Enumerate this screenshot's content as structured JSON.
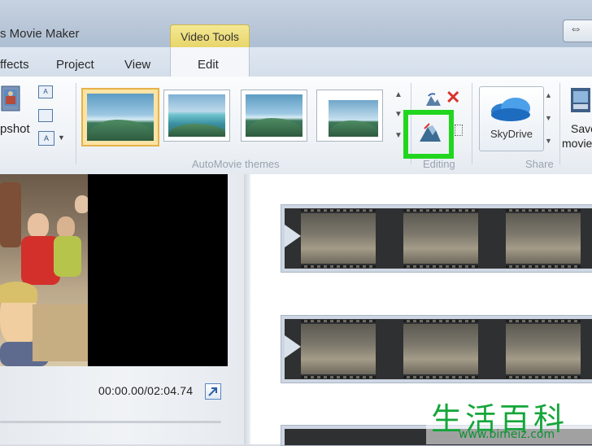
{
  "window": {
    "title": "s Movie Maker",
    "context_tab": "Video Tools"
  },
  "tabs": [
    {
      "label": "ffects"
    },
    {
      "label": "Project"
    },
    {
      "label": "View"
    },
    {
      "label": "Edit"
    }
  ],
  "ribbon": {
    "snapshot_label": "pshot",
    "groups": {
      "automovie": {
        "label": "AutoMovie themes"
      },
      "editing": {
        "label": "Editing"
      },
      "share": {
        "label": "Share"
      }
    },
    "skydrive_label": "SkyDrive",
    "save_movie_label_1": "Save",
    "save_movie_label_2": "movie"
  },
  "preview": {
    "timecode": "00:00.00/02:04.74"
  },
  "watermark": {
    "text": "生活百科",
    "url": "www.bimeiz.com"
  },
  "colors": {
    "highlight": "#22d61f",
    "selected_theme": "#e5b24a"
  },
  "icons": [
    "snapshot-icon",
    "caption-icon",
    "title-icon",
    "credits-icon",
    "rotate-icon",
    "remove-icon",
    "trim-icon",
    "select-all-icon",
    "skydrive-icon",
    "save-movie-icon",
    "expand-icon"
  ]
}
